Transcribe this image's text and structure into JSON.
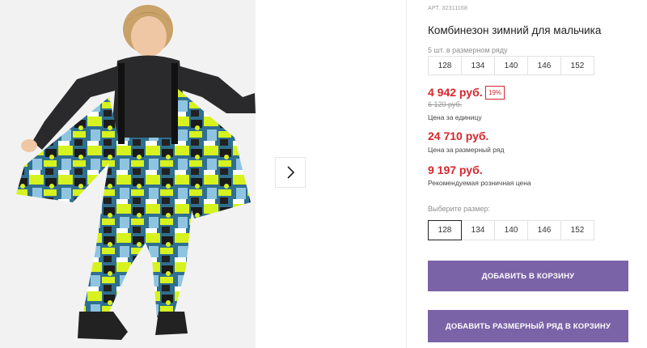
{
  "product": {
    "sku": "АРТ. 32311168",
    "title": "Комбинезон зимний для мальчика",
    "pack_label": "5 шт. в размерном ряду",
    "pack_sizes": [
      "128",
      "134",
      "140",
      "146",
      "152"
    ],
    "price_unit": "4 942 руб.",
    "discount": "19%",
    "old_price": "6 120 руб.",
    "price_unit_caption": "Цена за единицу",
    "price_range": "24 710 руб.",
    "price_range_caption": "Цена за размерный ряд",
    "price_retail": "9 197 руб.",
    "price_retail_caption": "Рекомендуемая розничная цена",
    "choose_size_label": "Выберите размер:",
    "sizes": [
      "128",
      "134",
      "140",
      "146",
      "152"
    ],
    "selected_size": "128"
  },
  "buttons": {
    "add_to_cart": "ДОБАВИТЬ В КОРЗИНУ",
    "add_pack_to_cart": "ДОБАВИТЬ РАЗМЕРНЫЙ РЯД В КОРЗИНУ"
  },
  "gallery": {
    "next_icon": "chevron-right-icon"
  },
  "colors": {
    "accent": "#7b63a7",
    "sale_red": "#d7262e"
  }
}
